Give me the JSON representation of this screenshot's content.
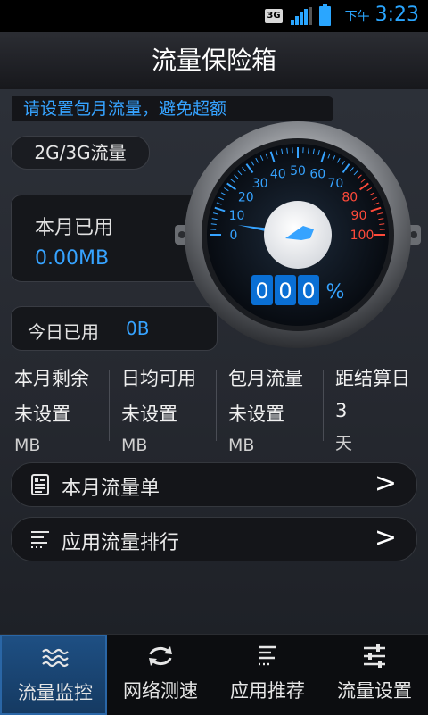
{
  "status_bar": {
    "network": "3G",
    "ampm": "下午",
    "time": "3:23"
  },
  "title": "流量保险箱",
  "notice": "请设置包月流量，避免超额",
  "traffic_type": "2G/3G流量",
  "month_used": {
    "label": "本月已用",
    "value": "0.00MB"
  },
  "today_used": {
    "label": "今日已用",
    "value": "0B"
  },
  "gauge": {
    "ticks": [
      "0",
      "10",
      "20",
      "30",
      "40",
      "50",
      "60",
      "70",
      "80",
      "90",
      "100"
    ],
    "digits": [
      "0",
      "0",
      "0"
    ],
    "percent_sign": "%",
    "level": 0,
    "colors": {
      "blue": "#36a3ff",
      "red": "#ff4a3a"
    }
  },
  "stats": [
    {
      "label": "本月剩余",
      "value": "未设置",
      "unit": "MB"
    },
    {
      "label": "日均可用",
      "value": "未设置",
      "unit": "MB"
    },
    {
      "label": "包月流量",
      "value": "未设置",
      "unit": "MB"
    },
    {
      "label": "距结算日",
      "value": "3",
      "unit": "天"
    }
  ],
  "menu": [
    {
      "label": "本月流量单",
      "icon": "document-icon",
      "arrow": ">"
    },
    {
      "label": "应用流量排行",
      "icon": "list-icon",
      "arrow": ">"
    }
  ],
  "tabs": [
    {
      "label": "流量监控",
      "icon": "waves-icon",
      "active": true
    },
    {
      "label": "网络测速",
      "icon": "refresh-icon",
      "active": false
    },
    {
      "label": "应用推荐",
      "icon": "menu-lines-icon",
      "active": false
    },
    {
      "label": "流量设置",
      "icon": "sliders-icon",
      "active": false
    }
  ],
  "accent_color": "#36a3ff"
}
